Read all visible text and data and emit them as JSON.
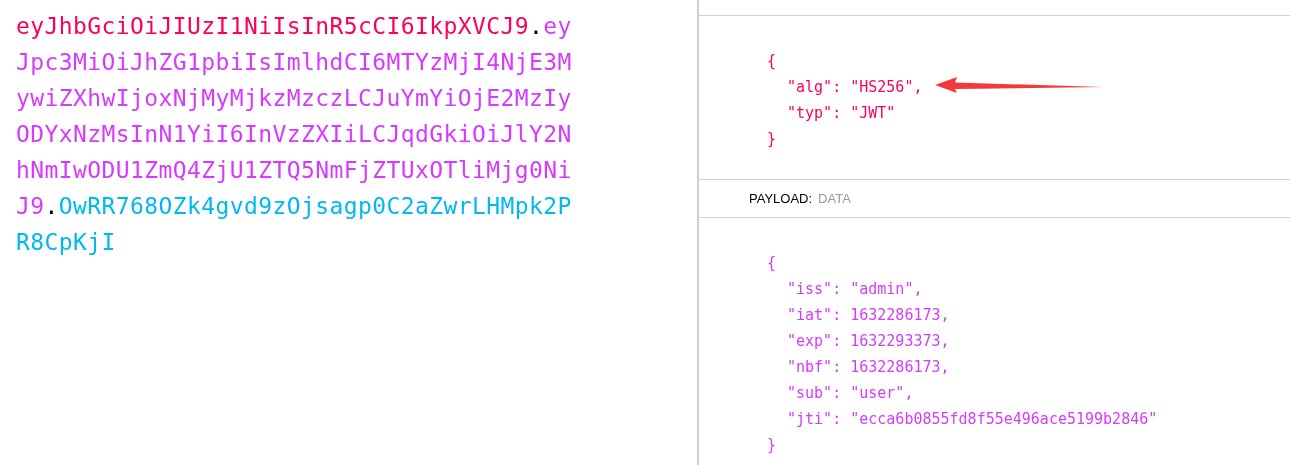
{
  "encoded": {
    "lines": [
      [
        {
          "kind": "header",
          "text": "eyJhbGciOiJIUzI1NiIsInR5cCI6IkpXVCJ9"
        },
        {
          "kind": "separator",
          "text": "."
        },
        {
          "kind": "payload",
          "text": "ey"
        }
      ],
      [
        {
          "kind": "payload",
          "text": "Jpc3MiOiJhZG1pbiIsImlhdCI6MTYzMjI4NjE3M"
        }
      ],
      [
        {
          "kind": "payload",
          "text": "ywiZXhwIjoxNjMyMjkzMzczLCJuYmYiOjE2MzIy"
        }
      ],
      [
        {
          "kind": "payload",
          "text": "ODYxNzMsInN1YiI6InVzZXIiLCJqdGkiOiJlY2N"
        }
      ],
      [
        {
          "kind": "payload",
          "text": "hNmIwODU1ZmQ4ZjU1ZTQ5NmFjZTUxOTliMjg0Ni"
        }
      ],
      [
        {
          "kind": "payload",
          "text": "J9"
        },
        {
          "kind": "separator",
          "text": "."
        },
        {
          "kind": "signature",
          "text": "OwRR768OZk4gvd9zOjsagp0C2aZwrLHMpk2P"
        }
      ],
      [
        {
          "kind": "signature",
          "text": "R8CpKjI"
        }
      ]
    ]
  },
  "decoded": {
    "header": {
      "open": "{",
      "entries": [
        "\"alg\": \"HS256\",",
        "\"typ\": \"JWT\""
      ],
      "close": "}"
    },
    "payload_label": {
      "title": "PAYLOAD:",
      "subtitle": "DATA"
    },
    "payload": {
      "open": "{",
      "entries": [
        "\"iss\": \"admin\",",
        "\"iat\": 1632286173,",
        "\"exp\": 1632293373,",
        "\"nbf\": 1632286173,",
        "\"sub\": \"user\",",
        "\"jti\": \"ecca6b0855fd8f55e496ace5199b2846\""
      ],
      "close": "}"
    }
  }
}
